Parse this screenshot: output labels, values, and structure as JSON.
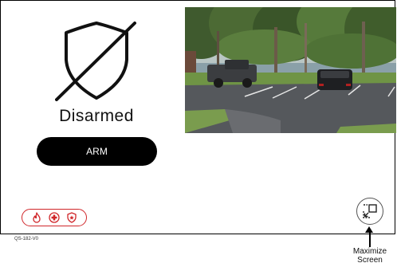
{
  "panel": {
    "status_text": "Disarmed",
    "arm_button_label": "ARM"
  },
  "emergency": {
    "buttons": [
      {
        "icon": "fire-icon"
      },
      {
        "icon": "medical-cross-icon"
      },
      {
        "icon": "police-badge-icon"
      }
    ],
    "accent_color": "#d0262a"
  },
  "camera": {
    "description_icon": "camera-feed-image"
  },
  "callout": {
    "line1": "Maximize",
    "line2": "Screen"
  },
  "figure_code": "QS-182-V0"
}
